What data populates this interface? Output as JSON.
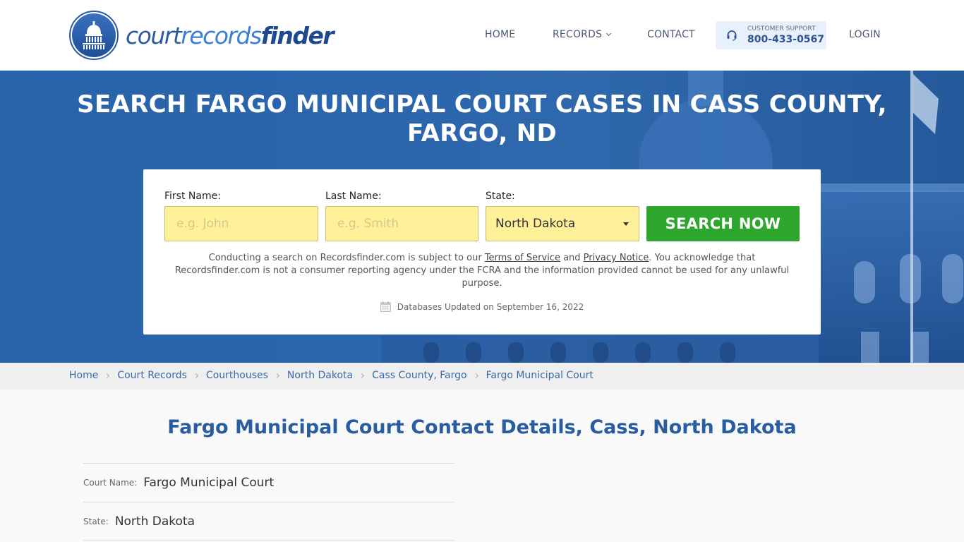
{
  "header": {
    "logo": {
      "part1": "court",
      "part2": "records",
      "part3": "finder"
    },
    "nav": {
      "home": "HOME",
      "records": "RECORDS",
      "contact": "CONTACT",
      "login": "LOGIN"
    },
    "support": {
      "label": "CUSTOMER SUPPORT",
      "phone": "800-433-0567",
      "icon": "headset-icon"
    }
  },
  "hero": {
    "title_line1": "SEARCH FARGO MUNICIPAL COURT CASES IN CASS COUNTY,",
    "title_line2": "FARGO, ND",
    "form": {
      "first_name_label": "First Name:",
      "first_name_placeholder": "e.g. John",
      "first_name_value": "",
      "last_name_label": "Last Name:",
      "last_name_placeholder": "e.g. Smith",
      "last_name_value": "",
      "state_label": "State:",
      "state_value": "North Dakota",
      "search_button": "SEARCH NOW"
    },
    "disclaimer": {
      "before": "Conducting a search on Recordsfinder.com is subject to our ",
      "terms": "Terms of Service",
      "and": " and ",
      "privacy": "Privacy Notice",
      "after": ". You acknowledge that Recordsfinder.com is not a consumer reporting agency under the FCRA and the information provided cannot be used for any unlawful purpose."
    },
    "db_updated": "Databases Updated on September 16, 2022"
  },
  "breadcrumb": [
    "Home",
    "Court Records",
    "Courthouses",
    "North Dakota",
    "Cass County, Fargo",
    "Fargo Municipal Court"
  ],
  "main": {
    "title": "Fargo Municipal Court Contact Details, Cass, North Dakota",
    "details": [
      {
        "label": "Court Name:",
        "value": "Fargo Municipal Court"
      },
      {
        "label": "State:",
        "value": "North Dakota"
      }
    ]
  },
  "colors": {
    "brand_blue": "#2a5d9f",
    "hero_blue": "#2862a9",
    "search_green": "#2ea52c",
    "input_yellow": "#fff09a",
    "support_bg": "#e8f1fb"
  }
}
